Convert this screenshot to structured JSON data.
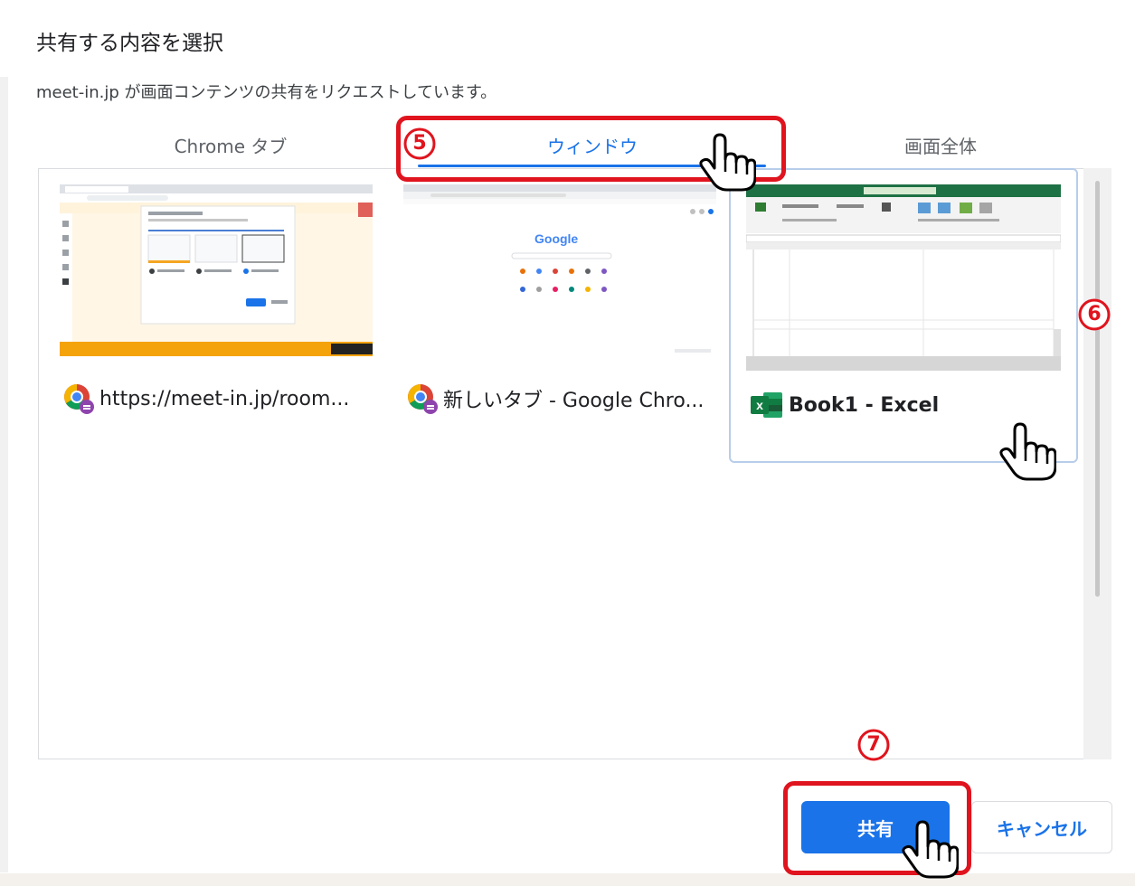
{
  "dialog": {
    "title": "共有する内容を選択",
    "subtitle": "meet-in.jp が画面コンテンツの共有をリクエストしています。"
  },
  "tabs": [
    {
      "label": "Chrome タブ",
      "active": false
    },
    {
      "label": "ウィンドウ",
      "active": true
    },
    {
      "label": "画面全体",
      "active": false
    }
  ],
  "sources": [
    {
      "label": "https://meet-in.jp/room...",
      "icon": "chrome-icon",
      "selected": false
    },
    {
      "label": "新しいタブ - Google Chro...",
      "icon": "chrome-icon",
      "selected": false,
      "thumbnail_brand": "Google"
    },
    {
      "label": "Book1 - Excel",
      "icon": "excel-icon",
      "selected": true
    }
  ],
  "buttons": {
    "share_label": "共有",
    "cancel_label": "キャンセル"
  },
  "callouts": [
    {
      "number": "5",
      "target": "tab-window"
    },
    {
      "number": "6",
      "target": "source-card-excel"
    },
    {
      "number": "7",
      "target": "share-button"
    }
  ],
  "colors": {
    "accent": "#1a73e8",
    "annotation_red": "#e0141e",
    "selected_border": "#b7cdea",
    "excel_green": "#1e7145"
  },
  "icons": {
    "hand_cursor": "hand-pointer-icon"
  }
}
